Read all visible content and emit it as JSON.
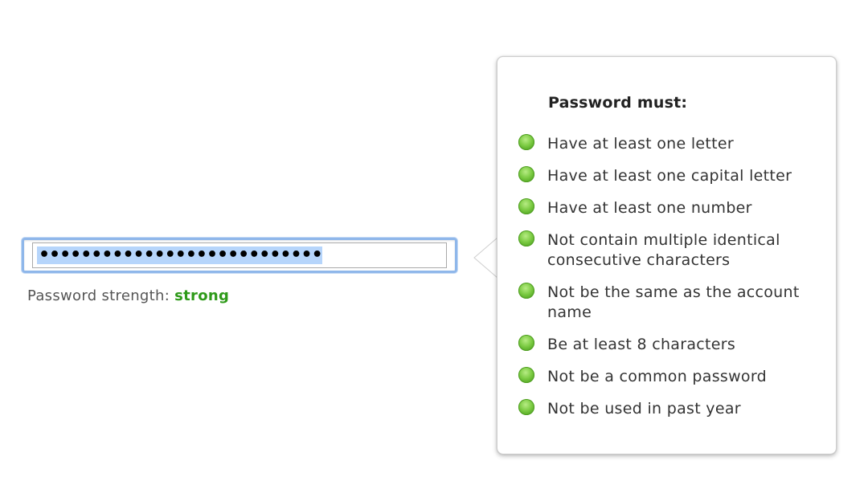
{
  "password_field": {
    "masked_value": "•••••••••••••••••••••••••••"
  },
  "strength": {
    "label": "Password strength:",
    "value": "strong",
    "value_color": "#2e9a19"
  },
  "popover": {
    "title": "Password must:",
    "requirements": [
      {
        "text": "Have at least one letter",
        "status": "met",
        "icon": "green-check-dot-icon"
      },
      {
        "text": "Have at least one capital letter",
        "status": "met",
        "icon": "green-check-dot-icon"
      },
      {
        "text": "Have at least one number",
        "status": "met",
        "icon": "green-check-dot-icon"
      },
      {
        "text": "Not contain multiple identical consecutive characters",
        "status": "met",
        "icon": "green-check-dot-icon"
      },
      {
        "text": "Not be the same as the account name",
        "status": "met",
        "icon": "green-check-dot-icon"
      },
      {
        "text": "Be at least 8 characters",
        "status": "met",
        "icon": "green-check-dot-icon"
      },
      {
        "text": "Not be a common password",
        "status": "met",
        "icon": "green-check-dot-icon"
      },
      {
        "text": "Not be used in past year",
        "status": "met",
        "icon": "green-check-dot-icon"
      }
    ]
  },
  "colors": {
    "focus_ring": "#8fb7ea",
    "selection": "#b6d5fb",
    "met_green": "#7ccb43"
  }
}
